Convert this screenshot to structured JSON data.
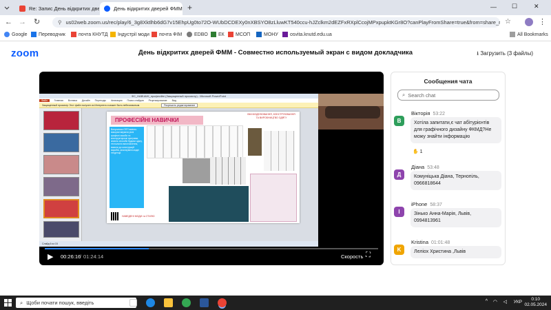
{
  "browser": {
    "tabs": [
      {
        "title": "Re: Запис День відкритих две",
        "active": false
      },
      {
        "title": "День відкритих дверей ФММ",
        "active": true
      }
    ],
    "new_tab_label": "+",
    "address": "us02web.zoom.us/rec/play/6_3g8Xktlhb6dG7v15EhpUg0to72O-WUbDCDEXy0nXBSYO8zLluwKT540ccu-hJZclkm2dEZFxRXplCcojMPxpupktKGr8O?canPlayFromShare=true&from=share_reco...",
    "bookmarks": [
      "Google",
      "Переводчик",
      "почта КНУТД",
      "Індустрії моди",
      "почта ФІМ",
      "EDBO",
      "ЕК",
      "МСОП",
      "МОНУ",
      "osvita.knutd.edu.ua"
    ],
    "all_bookmarks": "All Bookmarks"
  },
  "zoom": {
    "logo": "zoom",
    "title": "День відкритих дверей ФММ - Совместно используемый экран с видом докладчика",
    "download": "Загрузить (3 файлы)"
  },
  "player": {
    "current_time": "00:26:16",
    "duration": "01:24:14",
    "speed_label": "Скорость",
    "progress": 0.312
  },
  "slide": {
    "window_title": "ФС_НАВЧАНІ_професійні (Защищенный просмотр) - Microsoft PowerPoint",
    "menu": [
      "Файл",
      "Главная",
      "Вставка",
      "Дизайн",
      "Переходы",
      "Анимация",
      "Показ слайдов",
      "Рецензирование",
      "Вид"
    ],
    "protected_bar": "Защищенный просмотр  Этот файл получен из Интернета и может быть небезопасным.",
    "protected_button": "Разрешить редактирование",
    "slide_title": "ПРОФЕСІЙНІ НАВИЧКИ",
    "side_text": "ВМІ МОДЕЛЮВАННЯ, КОНСТРУЮВАННЯ ТА ВИРОБНИЦТВО ОДЯГУ",
    "blue_box_text": "Випускники ОПП вміють: використовувати різні графічні засоби та конструкторські програми, знають способи будови одягу, технологію виготовлення, вимоги до конструкцій виробів, аналізувати модні тенденції.",
    "link_text": "НАВЕДЕНІ МОДИ та СТИЛЮ",
    "statusbar": "Слайд 6 из 15"
  },
  "chat": {
    "title": "Сообщения чата",
    "search_placeholder": "Search chat",
    "messages": [
      {
        "initial": "В",
        "name": "Вікторія",
        "time": "53:22",
        "text": "Хотіла запитати,є чат абітурієнтів для графічного дизайну ФКМД?Не можу знайти інформацію",
        "color": "#2e9e5b",
        "reaction": "1"
      },
      {
        "initial": "Д",
        "name": "Діана",
        "time": "53:48",
        "text": "Комуніцька Діана, Тернопіль, 0966818644",
        "color": "#8e44ad"
      },
      {
        "initial": "I",
        "name": "iPhone",
        "time": "58:37",
        "text": "Зінько Анна-Марія, Львів, 0994813961",
        "color": "#8e44ad"
      },
      {
        "initial": "K",
        "name": "Kristina",
        "time": "01:01:48",
        "text": "Леліох Христина ,Львів",
        "color": "#f0a500"
      }
    ]
  },
  "taskbar": {
    "search_placeholder": "Щоби почати пошук, введіть",
    "lang": "УКР",
    "time": "0:10",
    "date": "02.05.2024"
  }
}
